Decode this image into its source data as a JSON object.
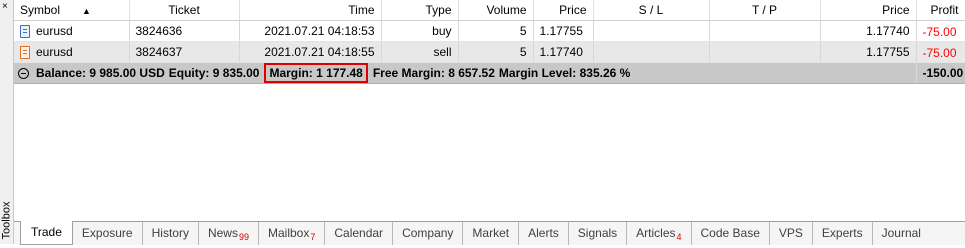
{
  "toolbox": {
    "close_glyph": "×",
    "label": "Toolbox"
  },
  "columns": [
    "Symbol",
    "Ticket",
    "Time",
    "Type",
    "Volume",
    "Price",
    "S / L",
    "T / P",
    "Price",
    "Profit"
  ],
  "rows": [
    {
      "symbol": "eurusd",
      "ticket": "3824636",
      "time": "2021.07.21 04:18:53",
      "type": "buy",
      "volume": "5",
      "price_open": "1.17755",
      "sl": "",
      "tp": "",
      "price_current": "1.17740",
      "profit": "-75.00"
    },
    {
      "symbol": "eurusd",
      "ticket": "3824637",
      "time": "2021.07.21 04:18:55",
      "type": "sell",
      "volume": "5",
      "price_open": "1.17740",
      "sl": "",
      "tp": "",
      "price_current": "1.17755",
      "profit": "-75.00"
    }
  ],
  "summary": {
    "balance": "Balance: 9 985.00 USD",
    "equity": "Equity: 9 835.00",
    "margin": "Margin: 1 177.48",
    "free_margin": "Free Margin: 8 657.52",
    "margin_level": "Margin Level: 835.26 %",
    "total_profit": "-150.00"
  },
  "row_close_glyph": "×",
  "tabs": [
    {
      "label": "Trade",
      "badge": ""
    },
    {
      "label": "Exposure",
      "badge": ""
    },
    {
      "label": "History",
      "badge": ""
    },
    {
      "label": "News",
      "badge": "99"
    },
    {
      "label": "Mailbox",
      "badge": "7"
    },
    {
      "label": "Calendar",
      "badge": ""
    },
    {
      "label": "Company",
      "badge": ""
    },
    {
      "label": "Market",
      "badge": ""
    },
    {
      "label": "Alerts",
      "badge": ""
    },
    {
      "label": "Signals",
      "badge": ""
    },
    {
      "label": "Articles",
      "badge": "4"
    },
    {
      "label": "Code Base",
      "badge": ""
    },
    {
      "label": "VPS",
      "badge": ""
    },
    {
      "label": "Experts",
      "badge": ""
    },
    {
      "label": "Journal",
      "badge": ""
    }
  ],
  "colors": {
    "loss": "#ff0000",
    "highlight_box": "#e00000",
    "summary_bg": "#c8c8c8",
    "badge": "#d00000"
  }
}
